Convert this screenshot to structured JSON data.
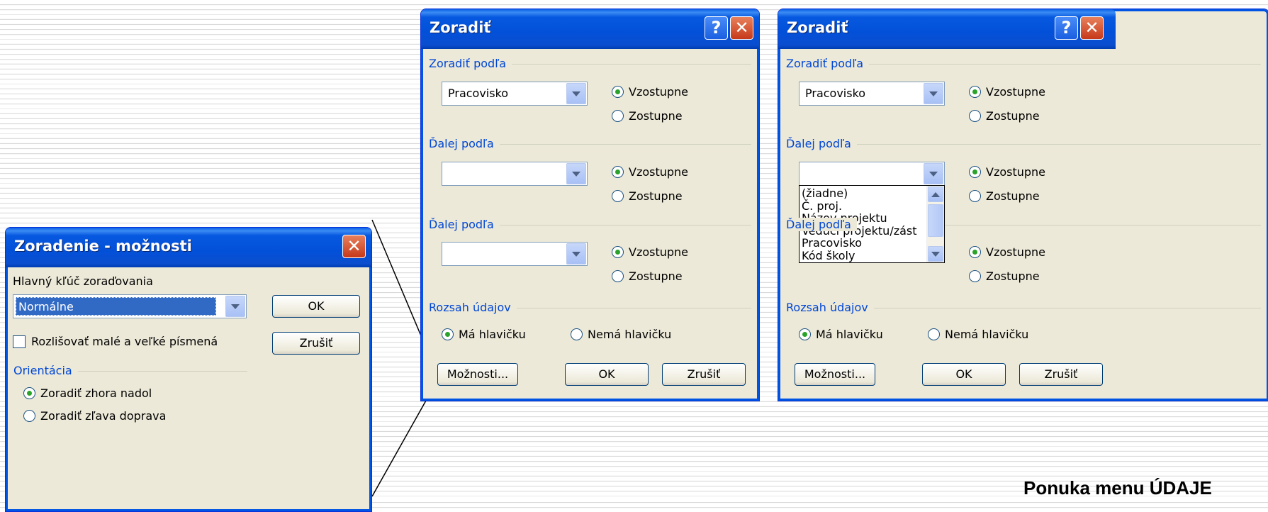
{
  "options_dialog": {
    "title": "Zoradenie - možnosti",
    "close_icon": "close-icon",
    "first_key_label": "Hlavný kľúč zoraďovania",
    "first_key_value": "Normálne",
    "case_sensitive_label": "Rozlišovať malé a veľké písmená",
    "case_sensitive_checked": false,
    "ok_label": "OK",
    "cancel_label": "Zrušiť",
    "orientation_label": "Orientácia",
    "top_to_bottom": "Zoradiť zhora nadol",
    "left_to_right": "Zoradiť zľava doprava"
  },
  "sort_dialog_1": {
    "title": "Zoradiť",
    "sort_by_label": "Zoradiť podľa",
    "sort_by_value": "Pracovisko",
    "then_by_1_label": "Ďalej podľa",
    "then_by_1_value": "",
    "then_by_2_label": "Ďalej podľa",
    "then_by_2_value": "",
    "ascending": "Vzostupne",
    "descending": "Zostupne",
    "range_label": "Rozsah údajov",
    "has_header": "Má hlavičku",
    "no_header": "Nemá hlavičku",
    "options_button": "Možnosti...",
    "ok_label": "OK",
    "cancel_label": "Zrušiť"
  },
  "sort_dialog_2": {
    "title": "Zoradiť",
    "sort_by_label": "Zoradiť podľa",
    "sort_by_value": "Pracovisko",
    "then_by_1_label": "Ďalej podľa",
    "then_by_1_value": "",
    "then_by_2_label": "Ďalej podľa",
    "ascending": "Vzostupne",
    "descending": "Zostupne",
    "range_label": "Rozsah údajov",
    "has_header": "Má hlavičku",
    "no_header": "Nemá hlavičku",
    "options_button": "Možnosti...",
    "ok_label": "OK",
    "cancel_label": "Zrušiť",
    "dropdown_items": [
      "(žiadne)",
      "Č. proj.",
      "Názov projektu",
      "Vedúci projektu/zást",
      "Pracovisko",
      "Kód školy"
    ]
  },
  "caption": "Ponuka menu ÚDAJE"
}
